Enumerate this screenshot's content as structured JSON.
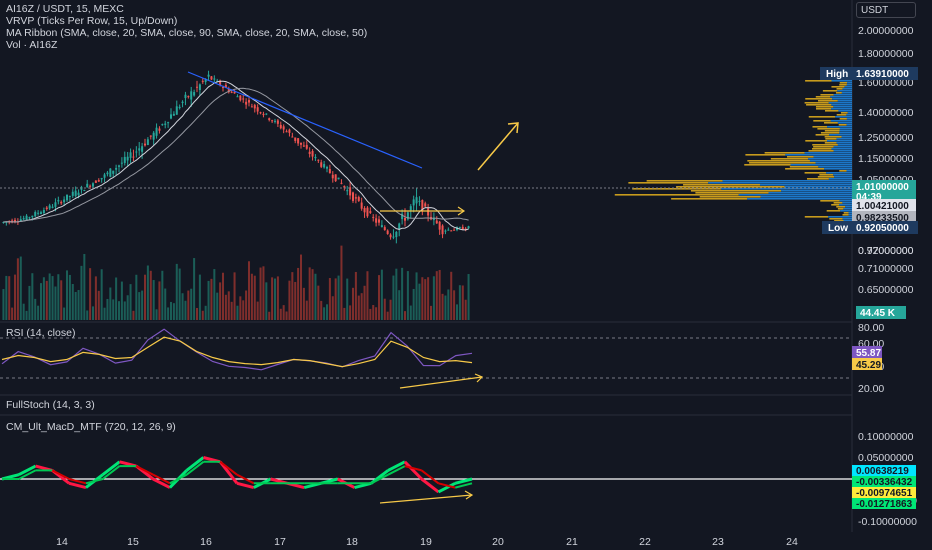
{
  "header": {
    "symbol_line": "AI16Z / USDT, 15, MEXC",
    "vrvp_line": "VRVP (Ticks Per Row, 15, Up/Down)",
    "ma_line": "MA Ribbon (SMA, close, 20, SMA, close, 90, SMA, close, 20, SMA, close, 50)",
    "vol_line": "Vol · AI16Z",
    "currency": "USDT"
  },
  "panes": {
    "rsi_label": "RSI (14, close)",
    "stoch_label": "FullStoch (14, 3, 3)",
    "macd_label": "CM_Ult_MacD_MTF (720, 12, 26, 9)"
  },
  "colors": {
    "background": "#131722",
    "up": "#26a69a",
    "down": "#ef5350",
    "ma": "#b2b5be",
    "trend_line": "#2962ff",
    "arrow": "#f7c948",
    "vrvp_up": "#1e88e5",
    "vrvp_down": "#e8b31c",
    "rsi": "#7e57c2",
    "rsi_signal": "#f7c948",
    "macd_up": "#00e676",
    "macd_down": "#ff1744",
    "macd_hist": "#2196f3"
  },
  "chart_data": [
    {
      "type": "candlestick",
      "pane": "price",
      "x_ticks": [
        "14",
        "15",
        "16",
        "17",
        "18",
        "19",
        "20",
        "21",
        "22",
        "23",
        "24"
      ],
      "y_ticks": [
        "2.00000000",
        "1.80000000",
        "1.60000000",
        "1.40000000",
        "1.25000000",
        "1.15000000",
        "1.05000000",
        "0.92000000"
      ],
      "ohlc_approx": [
        [
          1.03,
          1.08,
          0.98,
          1.05
        ],
        [
          1.05,
          1.12,
          1.02,
          1.1
        ],
        [
          1.1,
          1.18,
          1.05,
          1.16
        ],
        [
          1.16,
          1.25,
          1.12,
          1.22
        ],
        [
          1.22,
          1.35,
          1.18,
          1.3
        ],
        [
          1.3,
          1.45,
          1.25,
          1.4
        ],
        [
          1.4,
          1.55,
          1.36,
          1.52
        ],
        [
          1.52,
          1.66,
          1.45,
          1.62
        ],
        [
          1.62,
          1.64,
          1.52,
          1.55
        ],
        [
          1.55,
          1.58,
          1.46,
          1.48
        ],
        [
          1.48,
          1.5,
          1.38,
          1.4
        ],
        [
          1.4,
          1.42,
          1.28,
          1.3
        ],
        [
          1.3,
          1.32,
          1.18,
          1.2
        ],
        [
          1.2,
          1.22,
          1.05,
          1.08
        ],
        [
          1.08,
          1.1,
          0.96,
          0.98
        ],
        [
          0.98,
          1.25,
          0.95,
          1.12
        ],
        [
          1.12,
          1.15,
          0.97,
          1.0
        ],
        [
          1.0,
          1.06,
          0.98,
          1.01
        ]
      ],
      "badges": {
        "high_label": "High",
        "high_value": "1.63910000",
        "last_price": "1.01000000",
        "countdown": "04:39",
        "ma_value_1": "1.00421000",
        "ma_value_2": "0.98233500",
        "low_label": "Low",
        "low_value": "0.92050000"
      },
      "grid": false
    },
    {
      "type": "bar",
      "pane": "volume",
      "y_ticks": [
        "0.77000000",
        "0.71000000",
        "0.65000000"
      ],
      "last_volume": "44.45 K"
    },
    {
      "type": "line",
      "pane": "rsi",
      "y_ticks": [
        "80.00",
        "60.00",
        "40.00",
        "20.00"
      ],
      "series": [
        {
          "values": [
            45,
            55,
            50,
            42,
            48,
            60,
            52,
            47,
            50,
            65,
            75,
            68,
            55,
            48,
            44,
            42,
            40,
            45,
            50,
            48,
            42,
            38,
            44,
            50,
            72,
            60,
            45,
            42,
            50,
            56
          ]
        },
        {
          "values": [
            48,
            52,
            50,
            46,
            48,
            55,
            53,
            49,
            50,
            60,
            70,
            66,
            56,
            50,
            46,
            44,
            43,
            45,
            48,
            47,
            44,
            41,
            44,
            48,
            66,
            60,
            50,
            46,
            47,
            45
          ]
        }
      ],
      "badges": {
        "rsi": "55.87",
        "signal": "45.29"
      }
    },
    {
      "type": "line",
      "pane": "fullstoch",
      "series": []
    },
    {
      "type": "line",
      "pane": "macd",
      "y_ticks": [
        "0.10000000",
        "0.05000000",
        "0.00000000",
        "-0.05000000",
        "-0.10000000"
      ],
      "series": [
        {
          "values": [
            0.0,
            0.01,
            0.03,
            0.02,
            -0.01,
            -0.02,
            0.01,
            0.04,
            0.03,
            0.0,
            -0.02,
            0.02,
            0.05,
            0.04,
            -0.01,
            -0.02,
            0.0,
            -0.01,
            -0.02,
            -0.01,
            0.0,
            -0.02,
            -0.01,
            0.02,
            0.04,
            0.0,
            -0.03,
            -0.01,
            0.0
          ]
        },
        {
          "values": [
            0.0,
            0.0,
            0.02,
            0.02,
            0.0,
            -0.01,
            0.0,
            0.03,
            0.03,
            0.01,
            -0.01,
            0.01,
            0.04,
            0.04,
            0.01,
            -0.01,
            -0.01,
            -0.01,
            -0.01,
            -0.01,
            -0.01,
            -0.01,
            -0.01,
            0.01,
            0.03,
            0.02,
            -0.01,
            -0.02,
            -0.01
          ]
        }
      ],
      "badges": {
        "v1": "0.00638219",
        "v2": "-0.00336432",
        "v3": "-0.00974651",
        "v4": "-0.01271863"
      }
    }
  ]
}
